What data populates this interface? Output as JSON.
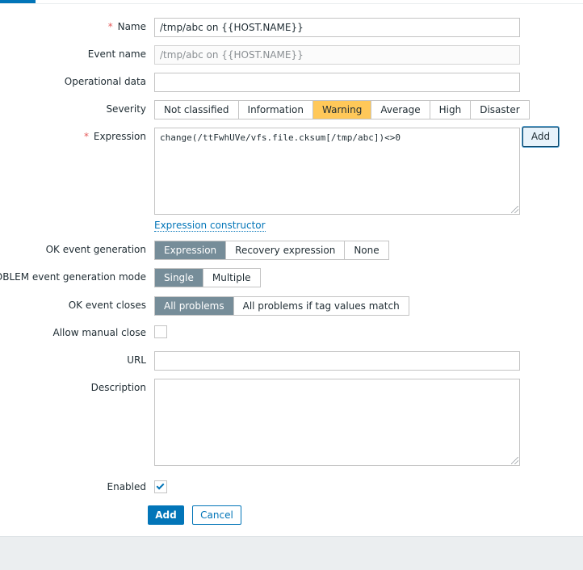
{
  "form": {
    "name": {
      "label": "Name",
      "required_mark": "*",
      "value": "/tmp/abc on {{HOST.NAME}}"
    },
    "event_name": {
      "label": "Event name",
      "placeholder": "/tmp/abc on {{HOST.NAME}}"
    },
    "operational_data": {
      "label": "Operational data",
      "value": ""
    },
    "severity": {
      "label": "Severity",
      "options": [
        "Not classified",
        "Information",
        "Warning",
        "Average",
        "High",
        "Disaster"
      ],
      "selected": "Warning",
      "selected_color": "#ffc859"
    },
    "expression": {
      "label": "Expression",
      "required_mark": "*",
      "value": "change(/ttFwhUVe/vfs.file.cksum[/tmp/abc])<>0",
      "add_button": "Add",
      "constructor_link": "Expression constructor"
    },
    "ok_event_generation": {
      "label": "OK event generation",
      "options": [
        "Expression",
        "Recovery expression",
        "None"
      ],
      "selected": "Expression"
    },
    "problem_mode": {
      "label": "PROBLEM event generation mode",
      "options": [
        "Single",
        "Multiple"
      ],
      "selected": "Single"
    },
    "ok_event_closes": {
      "label": "OK event closes",
      "options": [
        "All problems",
        "All problems if tag values match"
      ],
      "selected": "All problems"
    },
    "allow_manual_close": {
      "label": "Allow manual close",
      "checked": false
    },
    "url": {
      "label": "URL",
      "value": ""
    },
    "description": {
      "label": "Description",
      "value": ""
    },
    "enabled": {
      "label": "Enabled",
      "checked": true,
      "icon": "checkmark-icon"
    }
  },
  "actions": {
    "add": "Add",
    "cancel": "Cancel"
  },
  "colors": {
    "accent": "#0275b8",
    "selected_segment": "#768d99",
    "warning": "#ffc859",
    "required": "#e45959"
  }
}
